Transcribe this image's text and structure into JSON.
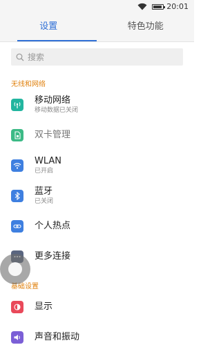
{
  "status_bar": {
    "time": "20:01",
    "wifi_icon": "wifi-icon",
    "battery_icon": "battery-icon",
    "battery_level": 0.8
  },
  "tabs": [
    {
      "label": "设置",
      "active": true
    },
    {
      "label": "特色功能",
      "active": false
    }
  ],
  "search": {
    "placeholder": "搜索",
    "icon": "search-icon"
  },
  "sections": {
    "wireless": {
      "header": "无线和网络",
      "items": [
        {
          "title": "移动网络",
          "subtitle": "移动数据已关闭",
          "icon": "antenna-icon",
          "color": "#22b59f"
        },
        {
          "title": "双卡管理",
          "subtitle": "",
          "icon": "sim-card-icon",
          "color": "#3cba86"
        },
        {
          "title": "WLAN",
          "subtitle": "已开启",
          "icon": "wifi-icon",
          "color": "#3e7fe0"
        },
        {
          "title": "蓝牙",
          "subtitle": "已关闭",
          "icon": "bluetooth-icon",
          "color": "#3e7fe0"
        },
        {
          "title": "个人热点",
          "subtitle": "",
          "icon": "link-icon",
          "color": "#3e7fe0"
        },
        {
          "title": "更多连接",
          "subtitle": "",
          "icon": "more-icon",
          "color": "#5a6680"
        }
      ]
    },
    "basic": {
      "header": "基础设置",
      "items": [
        {
          "title": "显示",
          "subtitle": "",
          "icon": "display-icon",
          "color": "#e9495a"
        },
        {
          "title": "声音和振动",
          "subtitle": "",
          "icon": "sound-icon",
          "color": "#7b5fd6"
        }
      ]
    }
  }
}
